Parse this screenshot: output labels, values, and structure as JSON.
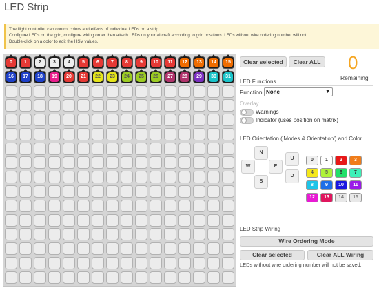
{
  "page": {
    "title": "LED Strip"
  },
  "note": {
    "lines": [
      "The flight controller can control colors and effects of individual LEDs on a strip.",
      "Configure LEDs on the grid, configure wiring order then attach LEDs on your aircraft according to grid positions. LEDs without wire ordering number will not",
      "Double-click on a color to edit the HSV values."
    ]
  },
  "grid": {
    "columns": 16,
    "rows": 16,
    "leds": [
      {
        "label": "0",
        "color": "#e53935"
      },
      {
        "label": "1",
        "color": "#e53935"
      },
      {
        "label": "2",
        "color": "#eeeeee",
        "text": "#333"
      },
      {
        "label": "3",
        "color": "#eeeeee",
        "text": "#333"
      },
      {
        "label": "4",
        "color": "#eeeeee",
        "text": "#333"
      },
      {
        "label": "5",
        "color": "#e53935"
      },
      {
        "label": "6",
        "color": "#e53935"
      },
      {
        "label": "7",
        "color": "#e53935"
      },
      {
        "label": "8",
        "color": "#e53935"
      },
      {
        "label": "9",
        "color": "#e53935"
      },
      {
        "label": "10",
        "color": "#e53935"
      },
      {
        "label": "11",
        "color": "#e53935"
      },
      {
        "label": "12",
        "color": "#ef6c00"
      },
      {
        "label": "13",
        "color": "#ef6c00"
      },
      {
        "label": "14",
        "color": "#ef6c00"
      },
      {
        "label": "15",
        "color": "#ef6c00"
      },
      {
        "label": "16",
        "color": "#1e40c8"
      },
      {
        "label": "17",
        "color": "#1e40c8"
      },
      {
        "label": "18",
        "color": "#1e40c8"
      },
      {
        "label": "19",
        "color": "#e91e8c"
      },
      {
        "label": "20",
        "color": "#e53935"
      },
      {
        "label": "21",
        "color": "#e53935"
      },
      {
        "label": "22",
        "color": "#e5e51a",
        "text": "#555"
      },
      {
        "label": "23",
        "color": "#e5e51a",
        "text": "#555"
      },
      {
        "label": "24",
        "color": "#9ccc22",
        "text": "#555"
      },
      {
        "label": "25",
        "color": "#9ccc22",
        "text": "#555"
      },
      {
        "label": "26",
        "color": "#9ccc22",
        "text": "#555"
      },
      {
        "label": "27",
        "color": "#b0336b"
      },
      {
        "label": "28",
        "color": "#b0336b"
      },
      {
        "label": "29",
        "color": "#7b2fbf"
      },
      {
        "label": "30",
        "color": "#19c3c9"
      },
      {
        "label": "31",
        "color": "#19c3c9"
      }
    ]
  },
  "buttons": {
    "clear_selected": "Clear selected",
    "clear_all": "Clear ALL"
  },
  "remaining": {
    "count": "0",
    "label": "Remaining"
  },
  "led_functions": {
    "heading": "LED Functions",
    "function_label": "Function",
    "function_value": "None",
    "overlay_label": "Overlay",
    "toggles": [
      {
        "label": "Warnings"
      },
      {
        "label": "Indicator (uses position on matrix)"
      }
    ]
  },
  "orientation": {
    "heading": "LED Orientation ('Modes & Orientation') and Color",
    "directions": {
      "n": "N",
      "w": "W",
      "e": "E",
      "s": "S",
      "u": "U",
      "d": "D"
    },
    "colors": [
      {
        "label": "0",
        "bg": "#f0f0f0",
        "text": "#333"
      },
      {
        "label": "1",
        "bg": "#ffffff",
        "text": "#333"
      },
      {
        "label": "2",
        "bg": "#e81818",
        "text": "#ffffff"
      },
      {
        "label": "3",
        "bg": "#f07c1a",
        "text": "#ffffff"
      },
      {
        "label": "4",
        "bg": "#f5e81a",
        "text": "#555"
      },
      {
        "label": "5",
        "bg": "#aef23a",
        "text": "#555"
      },
      {
        "label": "6",
        "bg": "#22e06a",
        "text": "#333"
      },
      {
        "label": "7",
        "bg": "#3ef0b8",
        "text": "#333"
      },
      {
        "label": "8",
        "bg": "#1ec4e8",
        "text": "#ffffff"
      },
      {
        "label": "9",
        "bg": "#1e6ee8",
        "text": "#ffffff"
      },
      {
        "label": "10",
        "bg": "#1a16e0",
        "text": "#ffffff"
      },
      {
        "label": "11",
        "bg": "#9a1ae8",
        "text": "#ffffff"
      },
      {
        "label": "12",
        "bg": "#e81ad4",
        "text": "#ffffff"
      },
      {
        "label": "13",
        "bg": "#e0165e",
        "text": "#ffffff"
      },
      {
        "label": "14",
        "bg": "#e8e8e8",
        "text": "#777"
      },
      {
        "label": "15",
        "bg": "#e8e8e8",
        "text": "#777"
      }
    ]
  },
  "wiring": {
    "heading": "LED Strip Wiring",
    "mode_button": "Wire Ordering Mode",
    "clear_selected": "Clear selected",
    "clear_all": "Clear ALL Wiring",
    "note": "LEDs without wire ordering number will not be saved."
  }
}
